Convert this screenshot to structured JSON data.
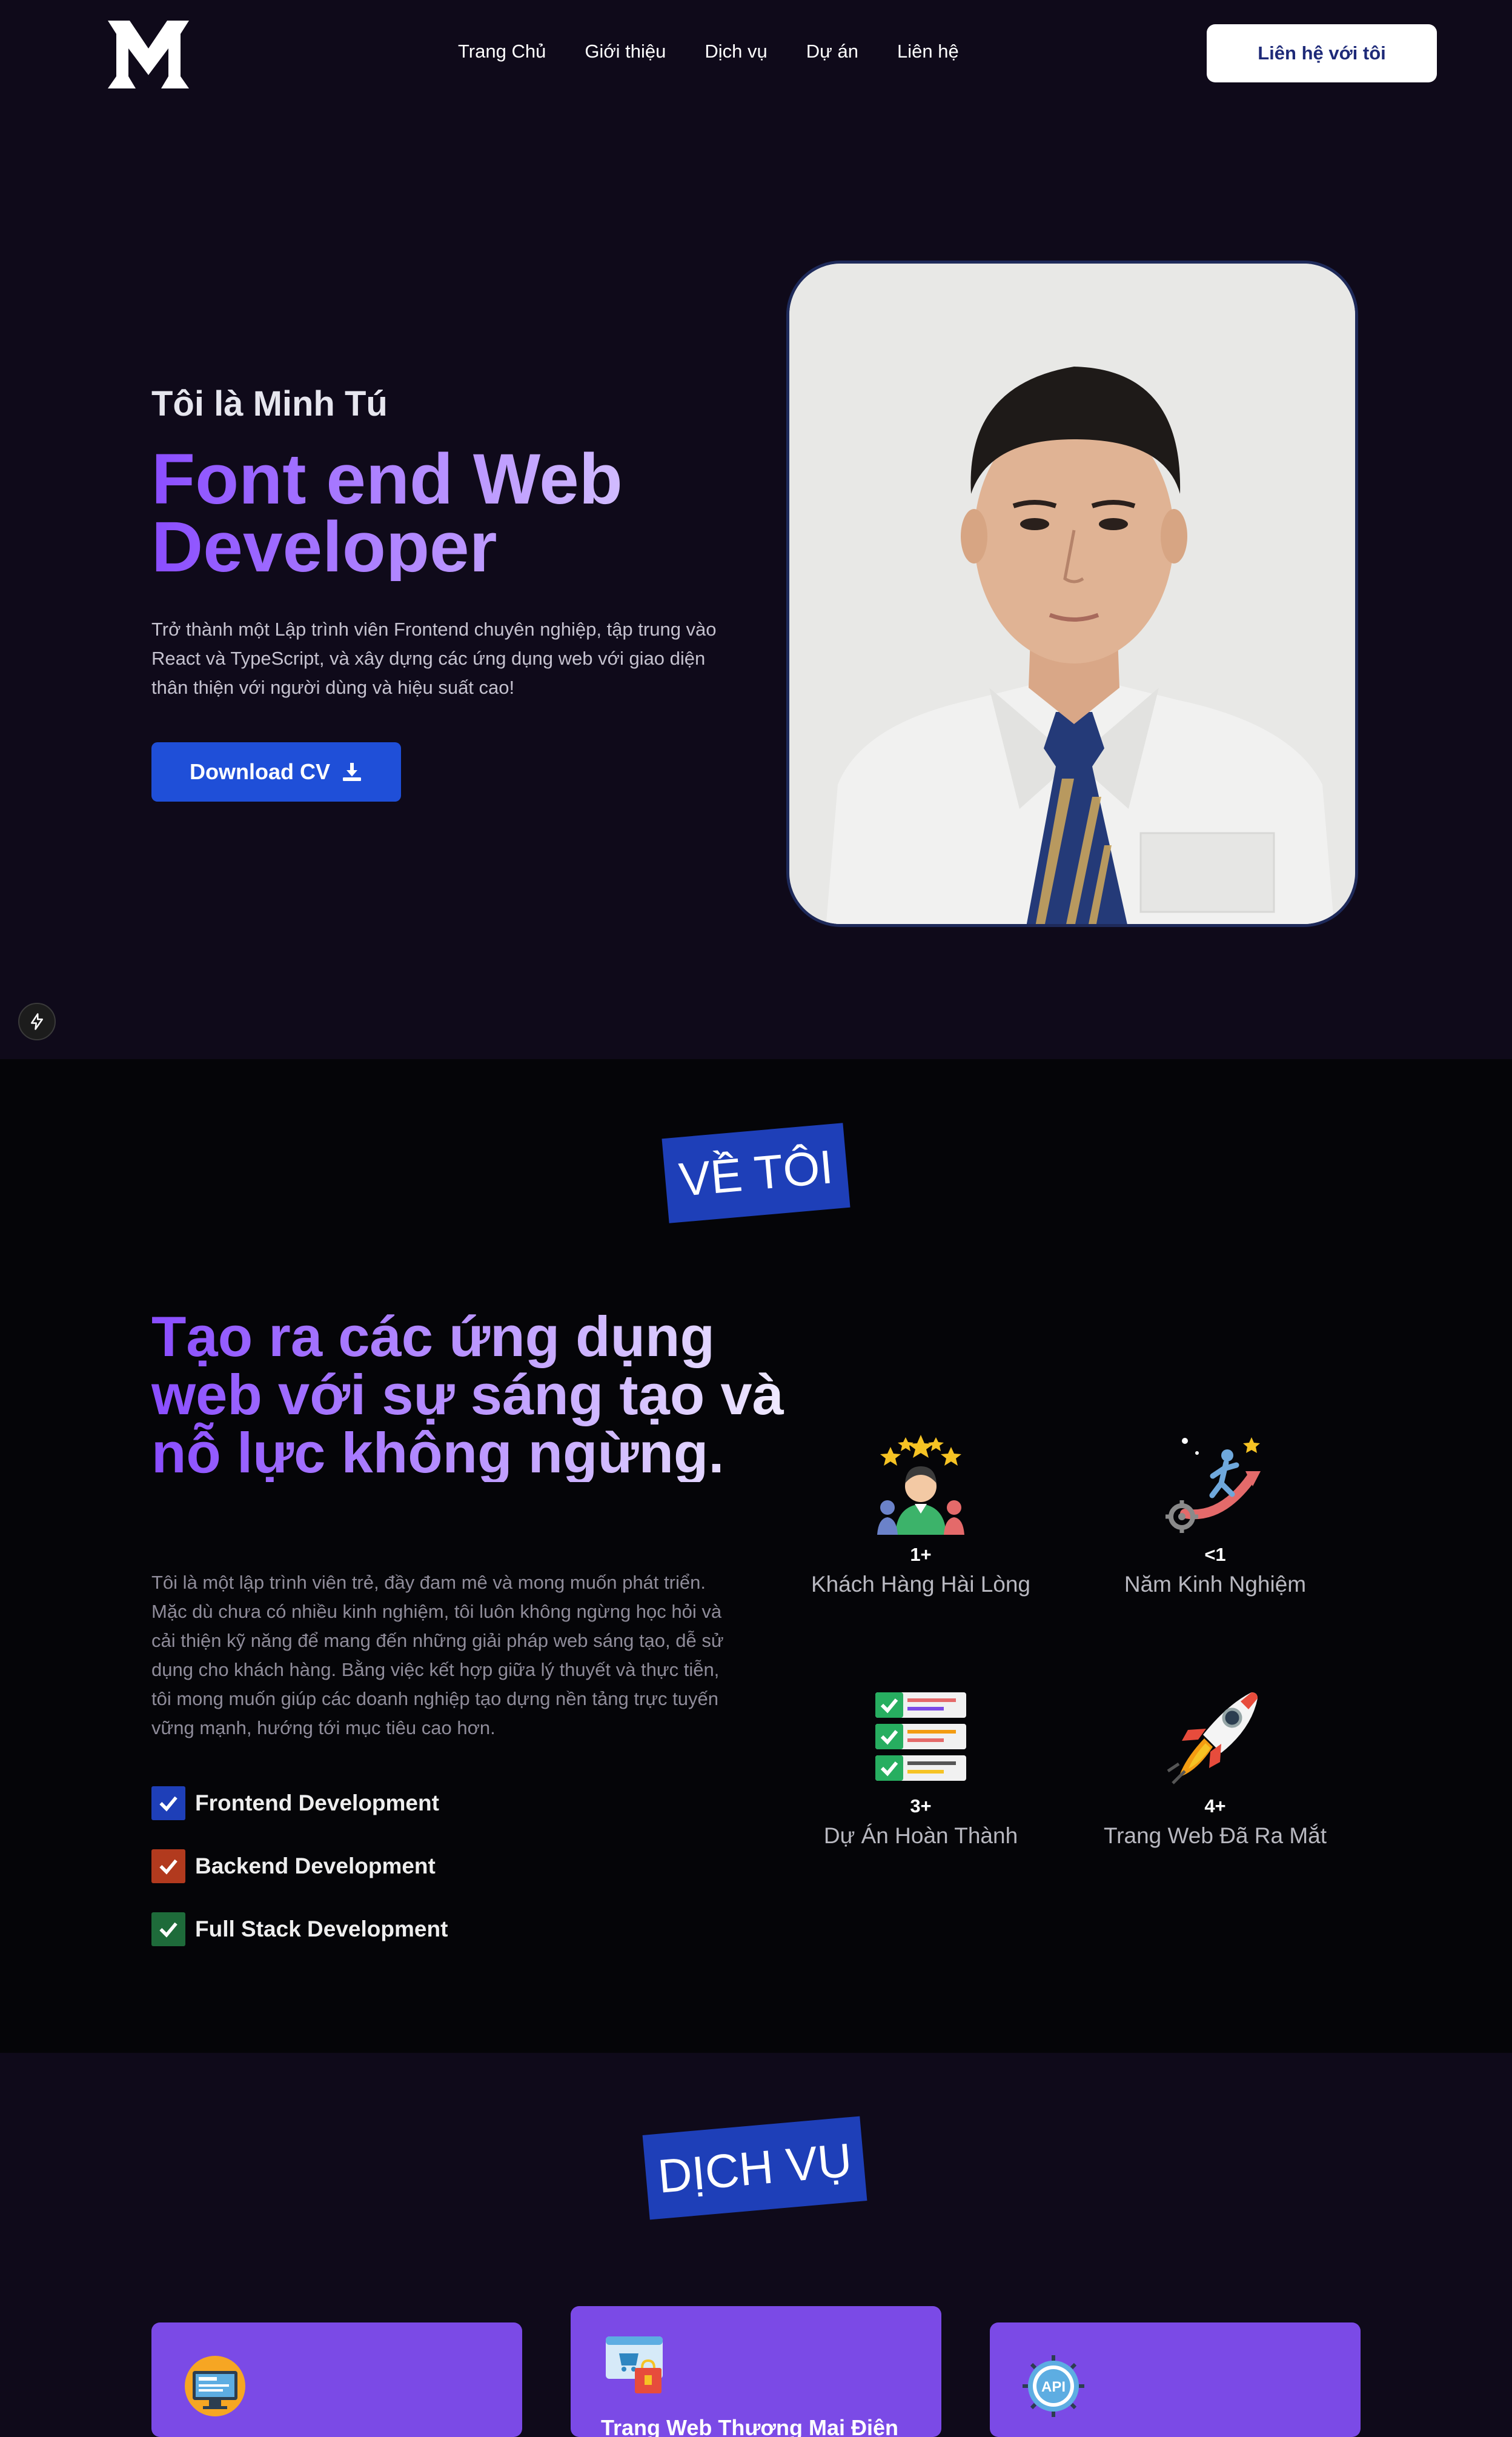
{
  "nav": {
    "links": [
      "Trang Chủ",
      "Giới thiệu",
      "Dịch vụ",
      "Dự án",
      "Liên hệ"
    ],
    "cta": "Liên hệ với tôi"
  },
  "hero": {
    "intro": "Tôi là Minh Tú",
    "title_line1": "Font end Web",
    "title_line2": "Developer",
    "description": "Trở thành một Lập trình viên Frontend chuyên nghiệp, tập trung vào React và TypeScript, và xây dựng các ứng dụng web với giao diện thân thiện với người dùng và hiệu suất cao!",
    "download_label": "Download CV"
  },
  "about": {
    "tag": "VỀ TÔI",
    "heading": "Tạo ra các ứng dụng web với sự sáng tạo và nỗ lực không ngừng.",
    "description": "Tôi là một lập trình viên trẻ, đầy đam mê và mong muốn phát triển. Mặc dù chưa có nhiều kinh nghiệm, tôi luôn không ngừng học hỏi và cải thiện kỹ năng để mang đến những giải pháp web sáng tạo, dễ sử dụng cho khách hàng. Bằng việc kết hợp giữa lý thuyết và thực tiễn, tôi mong muốn giúp các doanh nghiệp tạo dựng nền tảng trực tuyến vững mạnh, hướng tới mục tiêu cao hơn.",
    "skills": [
      {
        "label": "Frontend Development",
        "color": "#1e3fb8"
      },
      {
        "label": "Backend Development",
        "color": "#b23a1e"
      },
      {
        "label": "Full Stack Development",
        "color": "#1e6b3a"
      }
    ],
    "stats": [
      {
        "value": "1+",
        "label": "Khách Hàng Hài Lòng",
        "icon": "happy-customer-icon"
      },
      {
        "value": "<1",
        "label": "Năm Kinh Nghiệm",
        "icon": "growth-climber-icon"
      },
      {
        "value": "3+",
        "label": "Dự Án Hoàn Thành",
        "icon": "checklist-icon"
      },
      {
        "value": "4+",
        "label": "Trang Web Đã Ra Mắt",
        "icon": "rocket-icon"
      }
    ]
  },
  "services": {
    "tag": "DỊCH VỤ",
    "cards": [
      {
        "title": "",
        "icon": "web-design-icon"
      },
      {
        "title": "Trang Web Thương Mại Điện",
        "icon": "ecommerce-icon"
      },
      {
        "title": "",
        "icon": "api-icon"
      }
    ]
  },
  "colors": {
    "background": "#0f0a1a",
    "about_background": "#050508",
    "accent_blue": "#1f4fd8",
    "accent_purple": "#8a4dff",
    "card_purple": "#7b4ae6"
  }
}
